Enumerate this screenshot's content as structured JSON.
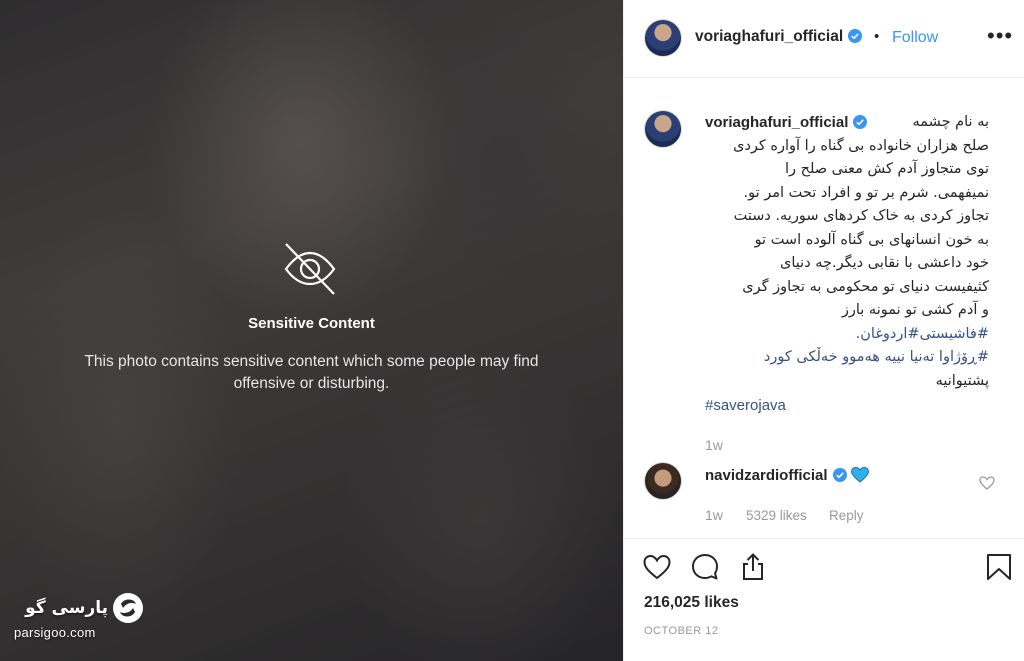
{
  "media": {
    "sensitive_title": "Sensitive Content",
    "sensitive_description": "This photo contains sensitive content which some people may find offensive or disturbing.",
    "icon": "eye-slash-icon"
  },
  "watermark": {
    "text_fa": "پارسی گو",
    "text_en": "parsigoo.com"
  },
  "header": {
    "username": "voriaghafuri_official",
    "verified": true,
    "separator": "•",
    "follow_label": "Follow",
    "more_label": "•••"
  },
  "caption": {
    "username": "voriaghafuri_official",
    "lines": [
      "به نام چشمه",
      "صلح هزاران خانواده بی گناه را آواره کردی",
      "توی متجاوز آدم کش معنی صلح را",
      "نمیفهمی. شرم بر تو و افراد تحت امر تو.",
      "تجاوز کردی به خاک کردهای سوریه. دستت",
      "به خون انسانهای بی گناه آلوده است تو",
      "خود داعشی با نقابی دیگر.چه دنیای",
      "کثیفیست دنیای تو محکومی به تجاوز گری",
      "و آدم کشی تو نمونه بارز",
      "#فاشیستی#اردوغان."
    ],
    "kurdish_lines": [
      "#ڕۆژاوا تەنیا نییە هەموو خەڵکی کورد",
      "پشتیوانیە"
    ],
    "hashtag": "#saverojava",
    "time": "1w"
  },
  "reply": {
    "username": "navidzardiofficial",
    "verified": true,
    "emoji": "blue-heart",
    "time": "1w",
    "likes": "5329 likes",
    "reply_label": "Reply"
  },
  "actions": {
    "icons": [
      "heart-icon",
      "comment-icon",
      "share-icon",
      "bookmark-icon"
    ],
    "likes": "216,025 likes",
    "date": "OCTOBER 12"
  },
  "colors": {
    "link": "#3897f0",
    "hashtag": "#385185",
    "muted": "#999999",
    "verified": "#3897f0"
  }
}
